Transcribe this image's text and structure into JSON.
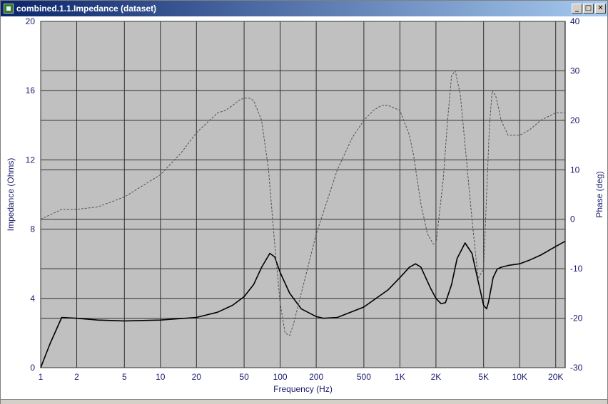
{
  "window": {
    "title": "combined.1.1.Impedance (dataset)",
    "buttons": {
      "minimize": "_",
      "maximize": "□",
      "close": "✕"
    }
  },
  "chart_data": {
    "type": "line",
    "title": "",
    "xlabel": "Frequency (Hz)",
    "ylabel": "Impedance (Ohms)",
    "y2label": "Phase (deg)",
    "x_scale": "log",
    "xlim": [
      1,
      24000
    ],
    "ylim": [
      0,
      20
    ],
    "y2lim": [
      -30,
      40
    ],
    "grid": true,
    "plot_background": "#c0c0c0",
    "x_ticks": [
      {
        "value": 1,
        "label": "1"
      },
      {
        "value": 2,
        "label": "2"
      },
      {
        "value": 5,
        "label": "5"
      },
      {
        "value": 10,
        "label": "10"
      },
      {
        "value": 20,
        "label": "20"
      },
      {
        "value": 50,
        "label": "50"
      },
      {
        "value": 100,
        "label": "100"
      },
      {
        "value": 200,
        "label": "200"
      },
      {
        "value": 500,
        "label": "500"
      },
      {
        "value": 1000,
        "label": "1K"
      },
      {
        "value": 2000,
        "label": "2K"
      },
      {
        "value": 5000,
        "label": "5K"
      },
      {
        "value": 10000,
        "label": "10K"
      },
      {
        "value": 20000,
        "label": "20K"
      }
    ],
    "y_ticks": [
      {
        "value": 0,
        "label": "0"
      },
      {
        "value": 4,
        "label": "4"
      },
      {
        "value": 8,
        "label": "8"
      },
      {
        "value": 12,
        "label": "12"
      },
      {
        "value": 16,
        "label": "16"
      },
      {
        "value": 20,
        "label": "20"
      }
    ],
    "y2_ticks": [
      {
        "value": -30,
        "label": "-30"
      },
      {
        "value": -20,
        "label": "-20"
      },
      {
        "value": -10,
        "label": "-10"
      },
      {
        "value": 0,
        "label": "0"
      },
      {
        "value": 10,
        "label": "10"
      },
      {
        "value": 20,
        "label": "20"
      },
      {
        "value": 30,
        "label": "30"
      },
      {
        "value": 40,
        "label": "40"
      }
    ],
    "series": [
      {
        "axis": "left",
        "style": "solid",
        "color": "#000000",
        "x": [
          1,
          1.2,
          1.5,
          2,
          3,
          5,
          10,
          20,
          30,
          40,
          50,
          60,
          70,
          82,
          90,
          100,
          120,
          150,
          200,
          230,
          300,
          500,
          800,
          1000,
          1200,
          1350,
          1500,
          1800,
          2000,
          2200,
          2400,
          2700,
          3000,
          3500,
          4000,
          4500,
          5000,
          5300,
          5500,
          6000,
          6500,
          7000,
          8000,
          10000,
          12000,
          15000,
          20000,
          24000
        ],
        "y": [
          0,
          1.4,
          2.9,
          2.85,
          2.75,
          2.7,
          2.75,
          2.9,
          3.2,
          3.6,
          4.1,
          4.8,
          5.8,
          6.6,
          6.4,
          5.5,
          4.3,
          3.4,
          2.95,
          2.85,
          2.9,
          3.5,
          4.5,
          5.2,
          5.8,
          6.0,
          5.8,
          4.6,
          4.0,
          3.7,
          3.75,
          4.8,
          6.3,
          7.2,
          6.6,
          5.0,
          3.6,
          3.4,
          3.8,
          5.2,
          5.7,
          5.8,
          5.9,
          6.0,
          6.2,
          6.5,
          7.0,
          7.3
        ]
      },
      {
        "axis": "right",
        "style": "dashed",
        "color": "#505050",
        "x": [
          1,
          1.5,
          2,
          3,
          5,
          10,
          15,
          20,
          30,
          35,
          40,
          45,
          50,
          55,
          60,
          70,
          80,
          90,
          100,
          110,
          120,
          130,
          150,
          200,
          300,
          400,
          500,
          600,
          700,
          800,
          1000,
          1200,
          1300,
          1500,
          1700,
          1900,
          2000,
          2300,
          2500,
          2700,
          2900,
          3200,
          3500,
          4000,
          4500,
          5000,
          5300,
          5600,
          5900,
          6300,
          6600,
          7000,
          8000,
          9000,
          10000,
          11000,
          12000,
          15000,
          20000,
          24000
        ],
        "y": [
          0,
          2,
          2,
          2.5,
          4.5,
          9,
          13.5,
          17.5,
          21.5,
          22,
          23,
          24,
          24.5,
          24.5,
          24,
          20,
          10,
          -5,
          -17,
          -23,
          -23.5,
          -21,
          -15,
          -3,
          10,
          16.5,
          20,
          22,
          23,
          23,
          22,
          17,
          13,
          3,
          -3,
          -5,
          -5,
          8,
          20,
          29,
          30,
          25,
          15,
          0,
          -12,
          -10,
          5,
          19,
          26,
          25,
          23,
          20,
          17,
          17,
          17,
          17.5,
          18,
          20,
          21.5,
          21.5
        ]
      }
    ]
  }
}
